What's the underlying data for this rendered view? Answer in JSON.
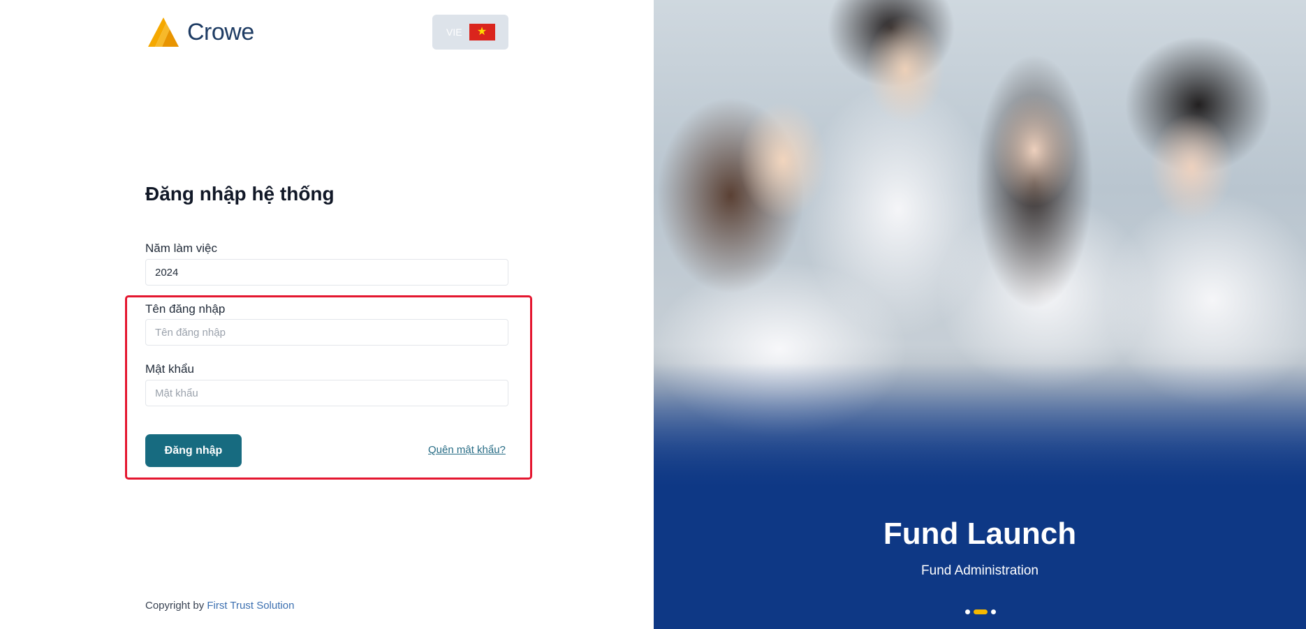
{
  "logo": {
    "brand_name": "Crowe",
    "icon": "crowe-logo-icon",
    "accent_color": "#f5a800"
  },
  "language": {
    "code": "VIE",
    "flag": "vietnam-flag-icon",
    "flag_star": "★"
  },
  "login": {
    "title": "Đăng nhập hệ thống",
    "year_label": "Năm làm việc",
    "year_value": "2024",
    "username_label": "Tên đăng nhập",
    "username_placeholder": "Tên đăng nhập",
    "password_label": "Mật khẩu",
    "password_placeholder": "Mật khẩu",
    "submit_label": "Đăng nhập",
    "forgot_label": "Quên mật khẩu?",
    "highlight_color": "#e4162f",
    "button_color": "#176b80"
  },
  "footer": {
    "prefix": "Copyright by ",
    "company": "First Trust Solution"
  },
  "hero": {
    "title": "Fund Launch",
    "subtitle": "Fund Administration",
    "background_color": "#0e3885",
    "slides": 3,
    "active_slide": 2
  }
}
